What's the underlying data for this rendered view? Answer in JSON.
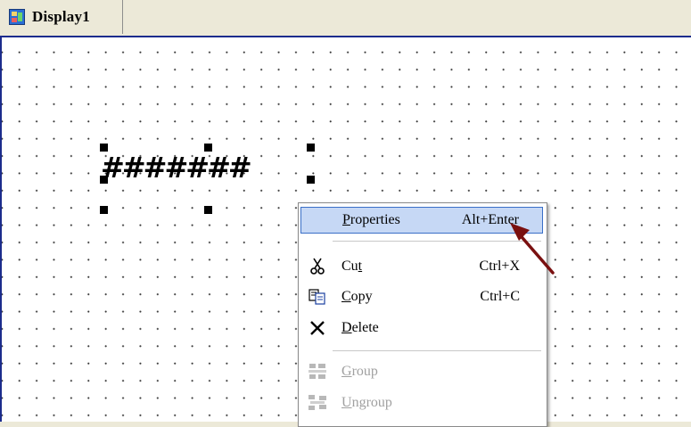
{
  "tab": {
    "label": "Display1",
    "icon": "display-icon"
  },
  "canvas": {
    "widget_text": "#######"
  },
  "context_menu": {
    "items": [
      {
        "label": "Properties",
        "mnemonic": "P",
        "accelerator": "Alt+Enter",
        "icon": "",
        "enabled": true,
        "highlighted": true
      },
      {
        "label": "Cut",
        "mnemonic": "t",
        "accelerator": "Ctrl+X",
        "icon": "scissors-icon",
        "enabled": true
      },
      {
        "label": "Copy",
        "mnemonic": "C",
        "accelerator": "Ctrl+C",
        "icon": "copy-icon",
        "enabled": true
      },
      {
        "label": "Delete",
        "mnemonic": "D",
        "accelerator": "",
        "icon": "delete-x-icon",
        "enabled": true
      },
      {
        "label": "Group",
        "mnemonic": "G",
        "accelerator": "",
        "icon": "group-icon",
        "enabled": false
      },
      {
        "label": "Ungroup",
        "mnemonic": "U",
        "accelerator": "",
        "icon": "ungroup-icon",
        "enabled": false
      }
    ]
  },
  "colors": {
    "highlight_bg": "#c6d8f5",
    "highlight_border": "#3a6fc7",
    "grid_border": "#1c2c8c",
    "arrow": "#7a1010"
  }
}
